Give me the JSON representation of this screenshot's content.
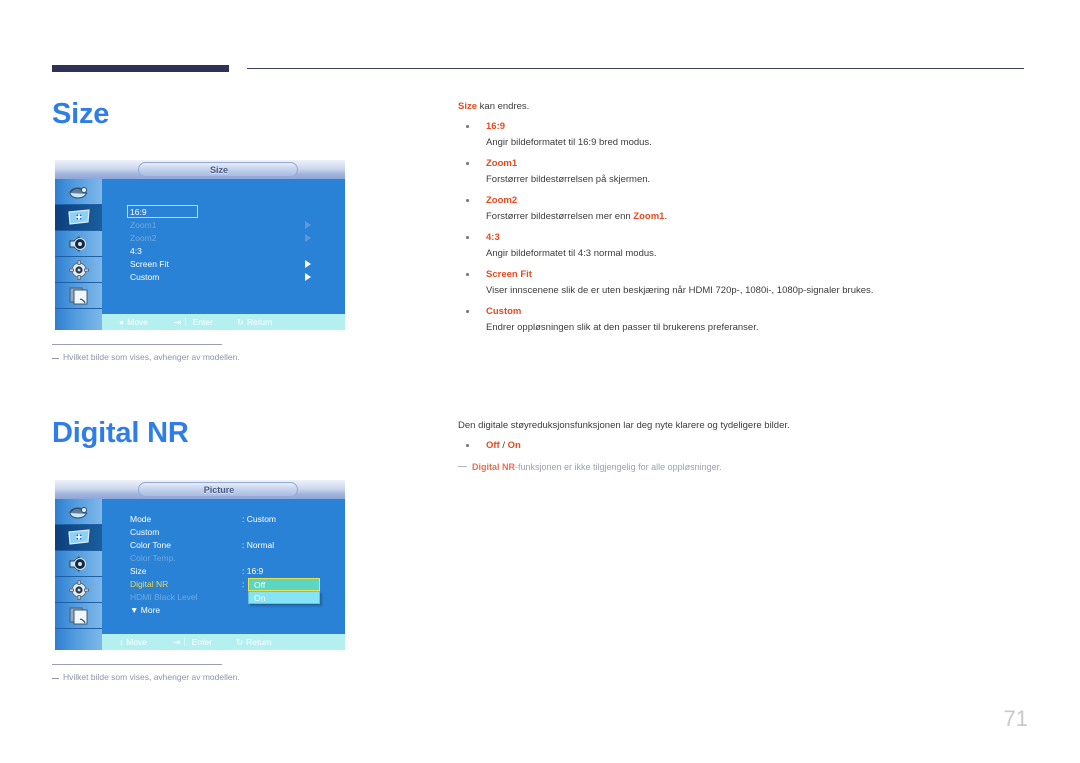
{
  "page": {
    "number": "71",
    "accent_blue": "#2f7ee8",
    "accent_orange": "#e8491f",
    "rule_navy": "#2f3256"
  },
  "sections": [
    {
      "id": "size",
      "title": "Size",
      "lead_keyword": "Size",
      "lead_rest": " kan endres.",
      "items": [
        {
          "term": "16:9",
          "desc": "Angir bildeformatet til 16:9 bred modus."
        },
        {
          "term": "Zoom1",
          "desc": "Forstørrer bildestørrelsen på skjermen."
        },
        {
          "term": "Zoom2",
          "desc_pre": "Forstørrer bildestørrelsen mer enn ",
          "desc_kw": "Zoom1",
          "desc_post": "."
        },
        {
          "term": "4:3",
          "desc": "Angir bildeformatet til 4:3 normal modus."
        },
        {
          "term": "Screen Fit",
          "desc": "Viser innscenene slik de er uten beskjæring når HDMI 720p-, 1080i-, 1080p-signaler brukes."
        },
        {
          "term": "Custom",
          "desc": "Endrer oppløsningen slik at den passer til brukerens preferanser."
        }
      ],
      "footnote": "Hvilket bilde som vises, avhenger av modellen."
    },
    {
      "id": "digital-nr",
      "title": "Digital NR",
      "lead": "Den digitale støyreduksjonsfunksjonen lar deg nyte klarere og tydeligere bilder.",
      "items": [
        {
          "term": "Off",
          "separator": " / ",
          "term2": "On"
        }
      ],
      "note_kw": "Digital NR",
      "note_rest": "-funksjonen er ikke tilgjengelig for alle oppløsninger.",
      "footnote": "Hvilket bilde som vises, avhenger av modellen."
    }
  ],
  "osd_size": {
    "title": "Size",
    "rail_icons": [
      "input-source-icon",
      "picture-icon",
      "sound-icon",
      "setup-gear-icon",
      "multi-control-icon"
    ],
    "active_rail_index": 1,
    "rows": [
      {
        "label": "16:9",
        "state": "selected",
        "arrow": false
      },
      {
        "label": "Zoom1",
        "state": "disabled",
        "arrow": true
      },
      {
        "label": "Zoom2",
        "state": "disabled",
        "arrow": true
      },
      {
        "label": "4:3",
        "state": "normal",
        "arrow": false
      },
      {
        "label": "Screen Fit",
        "state": "normal",
        "arrow": true
      },
      {
        "label": "Custom",
        "state": "normal",
        "arrow": true
      }
    ],
    "help": {
      "move": "Move",
      "enter": "Enter",
      "return": "Return"
    }
  },
  "osd_picture": {
    "title": "Picture",
    "rail_icons": [
      "input-source-icon",
      "picture-icon",
      "sound-icon",
      "setup-gear-icon",
      "multi-control-icon"
    ],
    "active_rail_index": 1,
    "rows": [
      {
        "label": "Mode",
        "value": ": Custom",
        "state": "normal"
      },
      {
        "label": "Custom",
        "value": "",
        "state": "normal"
      },
      {
        "label": "Color Tone",
        "value": ": Normal",
        "state": "normal"
      },
      {
        "label": "Color Temp.",
        "value": "",
        "state": "disabled"
      },
      {
        "label": "Size",
        "value": ": 16:9",
        "state": "normal"
      },
      {
        "label": "Digital NR",
        "value": ":",
        "state": "highlight"
      },
      {
        "label": "HDMI Black Level",
        "value": "",
        "state": "disabled"
      },
      {
        "label": "▼ More",
        "value": "",
        "state": "normal"
      }
    ],
    "dropdown": {
      "options": [
        "Off",
        "On"
      ],
      "selected": "Off"
    },
    "help": {
      "move": "Move",
      "enter": "Enter",
      "return": "Return"
    }
  }
}
